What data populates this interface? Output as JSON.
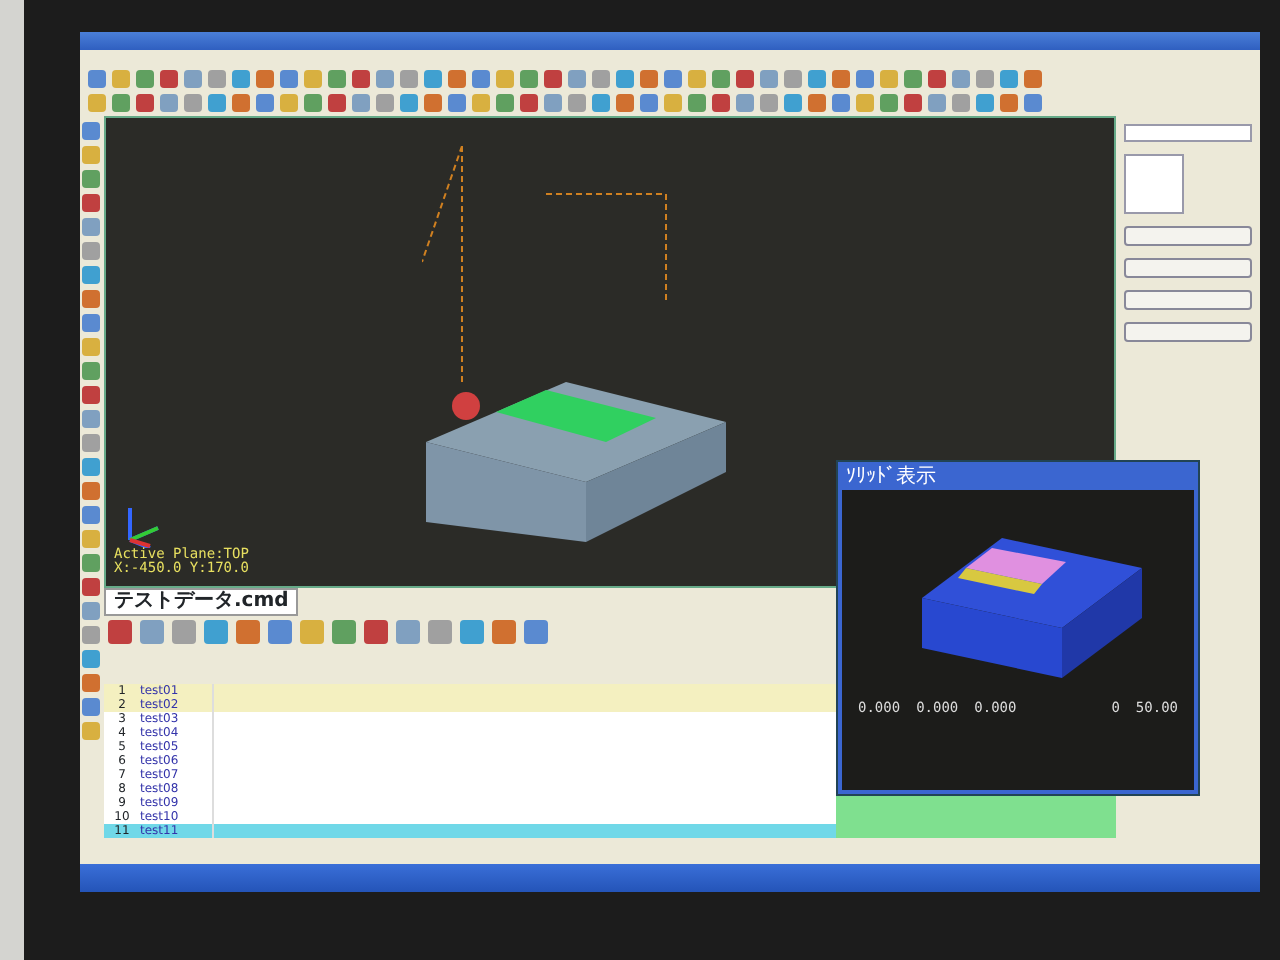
{
  "viewport": {
    "active_plane": "Active Plane:TOP",
    "coordinates": "X:-450.0 Y:170.0"
  },
  "document_tab": {
    "label": "テストデータ.cmd",
    "selected": true
  },
  "table": {
    "rows": [
      {
        "number": "1",
        "name": "test01",
        "selected": false,
        "kind": "done"
      },
      {
        "number": "2",
        "name": "test02",
        "selected": false,
        "kind": "done"
      },
      {
        "number": "3",
        "name": "test03",
        "selected": false,
        "kind": "plain"
      },
      {
        "number": "4",
        "name": "test04",
        "selected": false,
        "kind": "plain"
      },
      {
        "number": "5",
        "name": "test05",
        "selected": false,
        "kind": "plain"
      },
      {
        "number": "6",
        "name": "test06",
        "selected": false,
        "kind": "plain"
      },
      {
        "number": "7",
        "name": "test07",
        "selected": false,
        "kind": "plain"
      },
      {
        "number": "8",
        "name": "test08",
        "selected": false,
        "kind": "plain"
      },
      {
        "number": "9",
        "name": "test09",
        "selected": false,
        "kind": "plain"
      },
      {
        "number": "10",
        "name": "test10",
        "selected": false,
        "kind": "plain"
      },
      {
        "number": "11",
        "name": "test11",
        "selected": true,
        "kind": "plain"
      }
    ]
  },
  "solid_window": {
    "title": "ｿﾘｯﾄﾞ表示",
    "scale_labels": [
      "0.000",
      "0.000",
      "0.000"
    ],
    "ruler_start": "0",
    "ruler_end": "50.00"
  }
}
